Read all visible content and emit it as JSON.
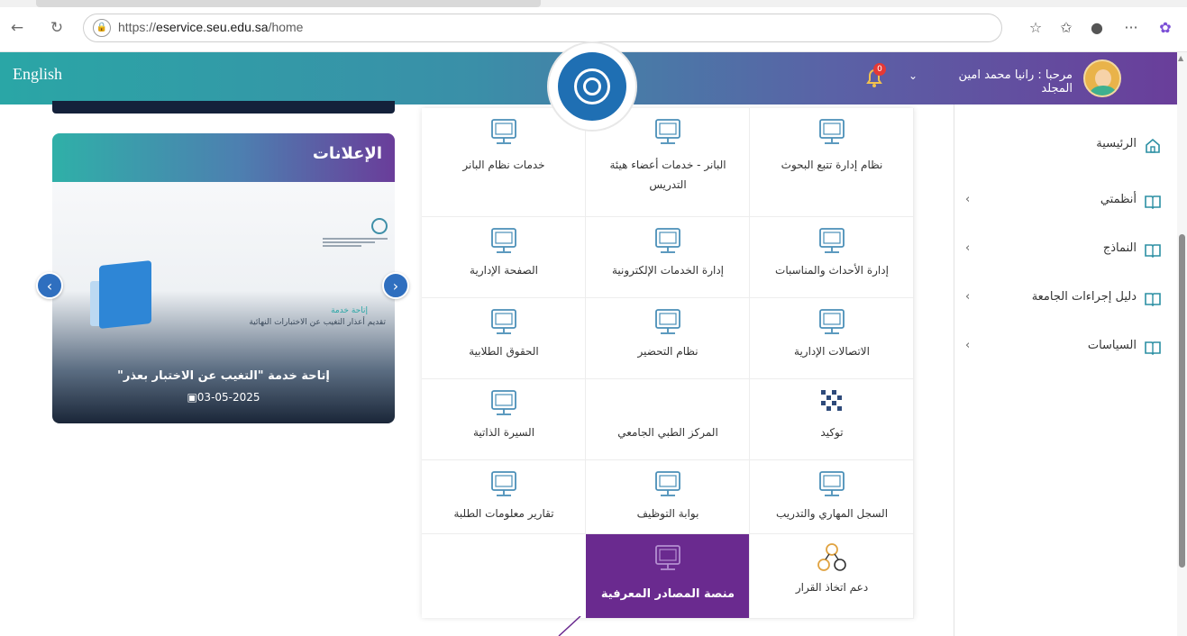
{
  "browser": {
    "url_prefix": "https://",
    "url_host": "eservice.seu.edu.sa",
    "url_path": "/home"
  },
  "header": {
    "language_link": "English",
    "notification_count": "0",
    "greeting": "مرحبا : رانيا محمد امين المجلد",
    "gradient_start": "#2aa6a6",
    "gradient_end": "#6a3d9a"
  },
  "sidebar": {
    "items": [
      {
        "label": "الرئيسية",
        "icon": "home-icon",
        "has_submenu": false
      },
      {
        "label": "أنظمتي",
        "icon": "book-icon",
        "has_submenu": true
      },
      {
        "label": "النماذج",
        "icon": "book-icon",
        "has_submenu": true
      },
      {
        "label": "دليل إجراءات الجامعة",
        "icon": "book-icon",
        "has_submenu": true
      },
      {
        "label": "السياسات",
        "icon": "book-icon",
        "has_submenu": true
      }
    ],
    "chevron": "‹"
  },
  "announcements": {
    "title": "الإعلانات",
    "slide_small_title": "إتاحة خدمة",
    "slide_small_text": "تقديم أعذار التغيب عن الاختبارات النهائية",
    "caption": "إتاحة خدمة \"التغيب عن الاختبار بعذر\"",
    "date": "03-05-2025",
    "prev_label": "‹",
    "next_label": "›"
  },
  "services": {
    "tiles": [
      {
        "label": "نظام إدارة تتبع البحوث",
        "icon": "research-tracking-icon"
      },
      {
        "label": "البانر - خدمات أعضاء هيئة التدريس",
        "icon": "faculty-services-icon"
      },
      {
        "label": "خدمات نظام البانر",
        "icon": "banner-services-icon"
      },
      {
        "label": "إدارة الأحداث والمناسبات",
        "icon": "events-icon"
      },
      {
        "label": "إدارة الخدمات الإلكترونية",
        "icon": "eservices-admin-icon"
      },
      {
        "label": "الصفحة الإدارية",
        "icon": "admin-page-icon"
      },
      {
        "label": "الاتصالات الإدارية",
        "icon": "admin-communications-icon"
      },
      {
        "label": "نظام التحضير",
        "icon": "attendance-icon"
      },
      {
        "label": "الحقوق الطلابية",
        "icon": "student-rights-icon"
      },
      {
        "label": "توكيد",
        "icon": "tawkeed-icon"
      },
      {
        "label": "المركز الطبي الجامعي",
        "icon": "medical-center-icon"
      },
      {
        "label": "السيرة الذاتية",
        "icon": "cv-icon"
      },
      {
        "label": "السجل المهاري والتدريب",
        "icon": "skills-record-icon"
      },
      {
        "label": "بوابة التوظيف",
        "icon": "employment-portal-icon"
      },
      {
        "label": "تقارير معلومات الطلبة",
        "icon": "student-reports-icon"
      },
      {
        "label": "دعم اتخاذ القرار",
        "icon": "decision-support-icon"
      },
      {
        "label": "منصة المصادر المعرفية",
        "icon": "knowledge-platform-icon",
        "highlighted": true
      }
    ],
    "icon_color": "#4a8fb8",
    "highlight_color": "#6a2a8f"
  }
}
